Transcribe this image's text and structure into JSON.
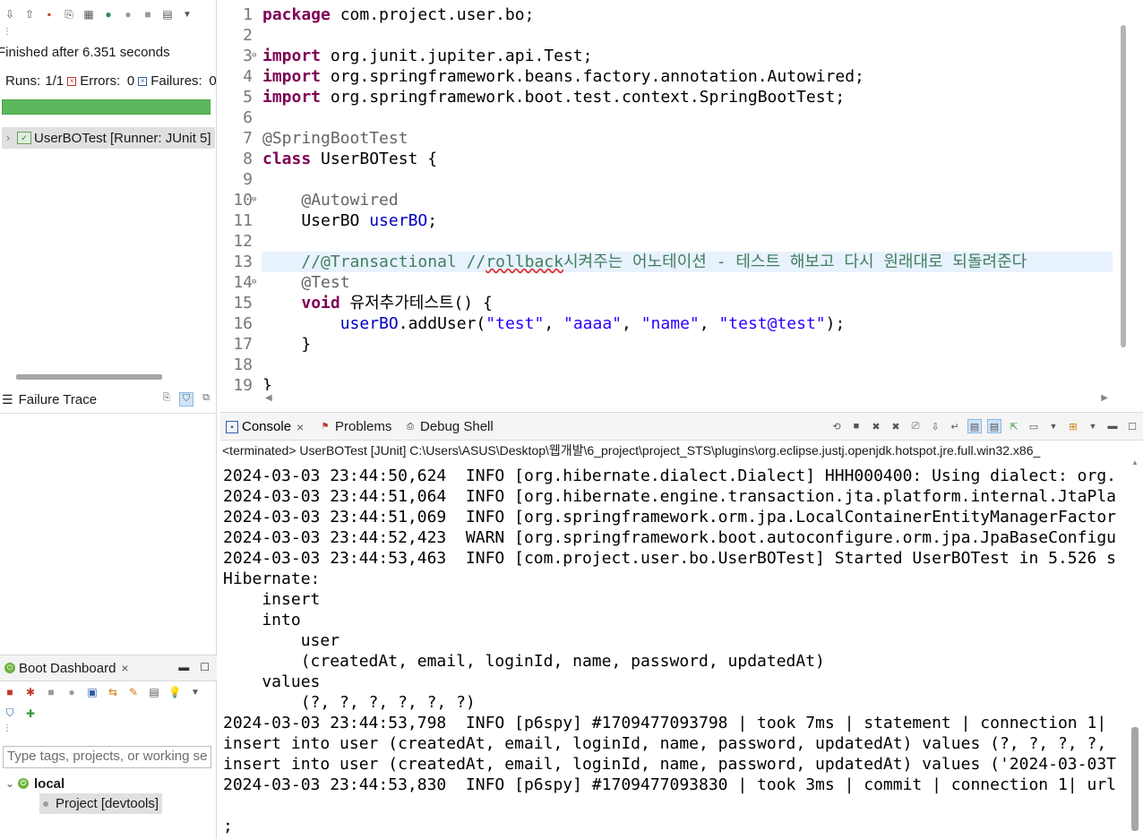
{
  "junit": {
    "status": "Finished after 6.351 seconds",
    "runs_label": "Runs:",
    "runs_value": "1/1",
    "errors_label": "Errors:",
    "errors_value": "0",
    "failures_label": "Failures:",
    "failures_value": "0",
    "progress_fraction": 1.0,
    "progress_color": "#5cb85c",
    "test_entry": "UserBOTest [Runner: JUnit 5]",
    "failure_trace_title": "Failure Trace"
  },
  "boot_dashboard": {
    "title": "Boot Dashboard",
    "filter_placeholder": "Type tags, projects, or working se",
    "target": "local",
    "project": "Project [devtools]"
  },
  "editor": {
    "lines": [
      {
        "n": "1",
        "html": "<span class='kw'>package</span> com.project.user.bo;"
      },
      {
        "n": "2",
        "html": ""
      },
      {
        "n": "3",
        "fold": true,
        "html": "<span class='kw'>import</span> org.junit.jupiter.api.Test;"
      },
      {
        "n": "4",
        "html": "<span class='kw'>import</span> org.springframework.beans.factory.annotation.Autowired;"
      },
      {
        "n": "5",
        "html": "<span class='kw'>import</span> org.springframework.boot.test.context.SpringBootTest;"
      },
      {
        "n": "6",
        "html": ""
      },
      {
        "n": "7",
        "html": "<span class='ann'>@SpringBootTest</span>"
      },
      {
        "n": "8",
        "html": "<span class='kw'>class</span> UserBOTest {"
      },
      {
        "n": "9",
        "html": ""
      },
      {
        "n": "10",
        "fold": true,
        "html": "    <span class='ann'>@Autowired</span>"
      },
      {
        "n": "11",
        "html": "    UserBO <span class='fld'>userBO</span>;"
      },
      {
        "n": "12",
        "html": ""
      },
      {
        "n": "13",
        "hl": true,
        "html": "    <span class='cmt'>//@Transactional //<span class='squig'>rollback</span>시켜주는 어노테이션 - 테스트 해보고 다시 원래대로 되돌려준다</span>"
      },
      {
        "n": "14",
        "fold": true,
        "html": "    <span class='ann'>@Test</span>"
      },
      {
        "n": "15",
        "html": "    <span class='kw'>void</span> 유저추가테스트() {"
      },
      {
        "n": "16",
        "html": "        <span class='fld'>userBO</span>.addUser(<span class='str'>\"test\"</span>, <span class='str'>\"aaaa\"</span>, <span class='str'>\"name\"</span>, <span class='str'>\"test@test\"</span>);"
      },
      {
        "n": "17",
        "html": "    }"
      },
      {
        "n": "18",
        "html": ""
      },
      {
        "n": "19",
        "html": "}"
      }
    ]
  },
  "console": {
    "tabs": [
      "Console",
      "Problems",
      "Debug Shell"
    ],
    "terminated_line": "<terminated> UserBOTest [JUnit] C:\\Users\\ASUS\\Desktop\\웹개발\\6_project\\project_STS\\plugins\\org.eclipse.justj.openjdk.hotspot.jre.full.win32.x86_",
    "lines": [
      "2024-03-03 23:44:50,624  INFO [org.hibernate.dialect.Dialect] HHH000400: Using dialect: org.",
      "2024-03-03 23:44:51,064  INFO [org.hibernate.engine.transaction.jta.platform.internal.JtaPla",
      "2024-03-03 23:44:51,069  INFO [org.springframework.orm.jpa.LocalContainerEntityManagerFactor",
      "2024-03-03 23:44:52,423  WARN [org.springframework.boot.autoconfigure.orm.jpa.JpaBaseConfigu",
      "2024-03-03 23:44:53,463  INFO [com.project.user.bo.UserBOTest] Started UserBOTest in 5.526 s",
      "Hibernate: ",
      "    insert ",
      "    into",
      "        user",
      "        (createdAt, email, loginId, name, password, updatedAt) ",
      "    values",
      "        (?, ?, ?, ?, ?, ?)",
      "2024-03-03 23:44:53,798  INFO [p6spy] #1709477093798 | took 7ms | statement | connection 1|",
      "insert into user (createdAt, email, loginId, name, password, updatedAt) values (?, ?, ?, ?,",
      "insert into user (createdAt, email, loginId, name, password, updatedAt) values ('2024-03-03T",
      "2024-03-03 23:44:53,830  INFO [p6spy] #1709477093830 | took 3ms | commit | connection 1| url",
      "",
      ";"
    ]
  },
  "colors": {
    "keyword": "#7f0055",
    "annotation": "#646464",
    "field": "#0000c0",
    "string": "#2a00ff",
    "comment": "#3f7f5f",
    "highlight_line": "#e8f2fe"
  }
}
